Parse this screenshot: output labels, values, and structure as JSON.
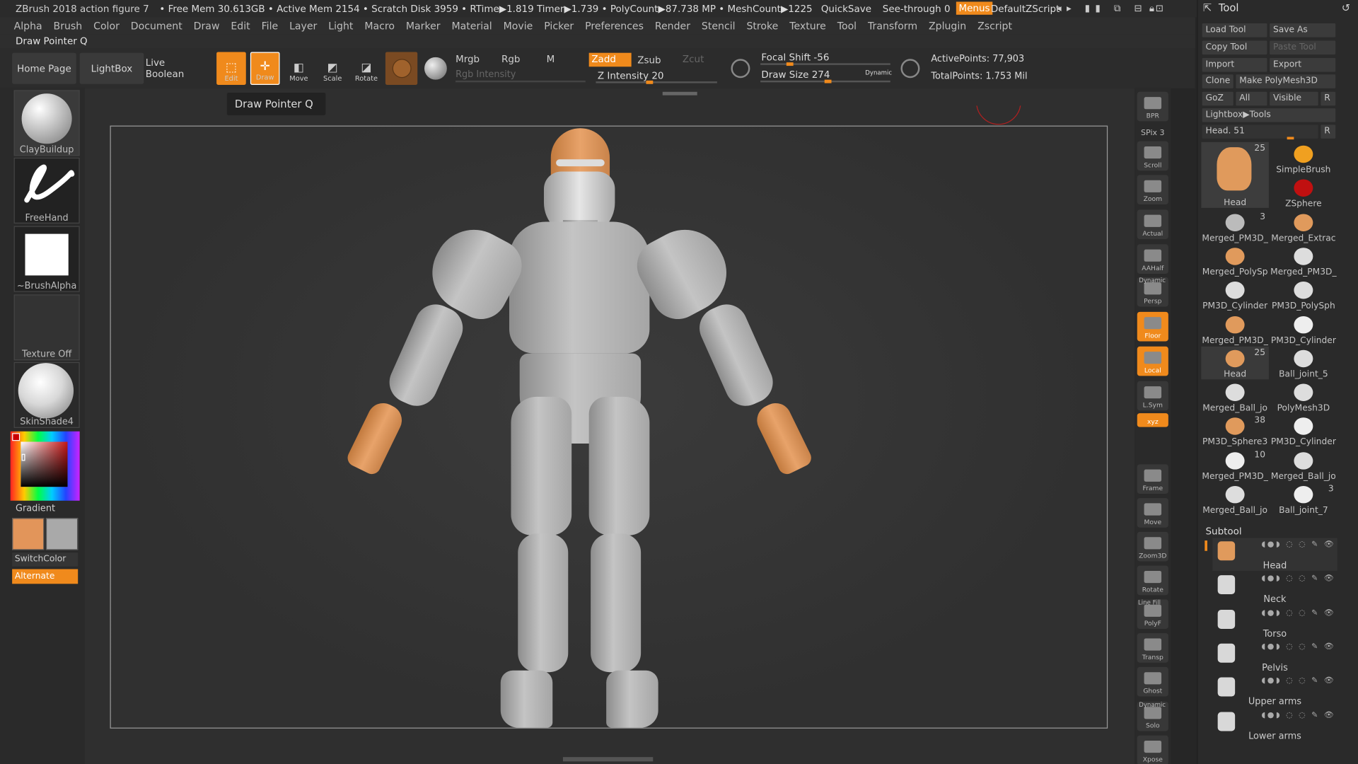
{
  "app": {
    "title": "ZBrush 2018 action figure 7",
    "stats": "• Free Mem 30.613GB • Active Mem 2154 • Scratch Disk 3959 • RTime▶1.819 Timer▶1.739 • PolyCount▶87.738 MP • MeshCount▶1225",
    "quicksave": "QuickSave",
    "seethrough": "See-through  0",
    "menus": "Menus",
    "zscript": "DefaultZScript"
  },
  "menubar": [
    "Alpha",
    "Brush",
    "Color",
    "Document",
    "Draw",
    "Edit",
    "File",
    "Layer",
    "Light",
    "Macro",
    "Marker",
    "Material",
    "Movie",
    "Picker",
    "Preferences",
    "Render",
    "Stencil",
    "Stroke",
    "Texture",
    "Tool",
    "Transform",
    "Zplugin",
    "Zscript"
  ],
  "status_text": "Draw Pointer Q",
  "toolbar": {
    "home": "Home Page",
    "lightbox": "LightBox",
    "liveboolean": "Live Boolean",
    "edit": "Edit",
    "draw": "Draw",
    "move": "Move",
    "scale": "Scale",
    "rotate": "Rotate",
    "mrgb": "Mrgb",
    "rgb": "Rgb",
    "m": "M",
    "zadd": "Zadd",
    "zsub": "Zsub",
    "zcut": "Zcut",
    "rgb_intensity": "Rgb Intensity",
    "z_intensity": "Z Intensity 20",
    "focal_shift": "Focal Shift -56",
    "draw_size": "Draw Size 274",
    "dynamic": "Dynamic",
    "active_points": "ActivePoints: 77,903",
    "total_points": "TotalPoints: 1.753 Mil"
  },
  "tooltip": "Draw Pointer  Q",
  "left": {
    "brush": "ClayBuildup",
    "stroke": "FreeHand",
    "alpha": "~BrushAlpha",
    "texture": "Texture Off",
    "material": "SkinShade4",
    "gradient": "Gradient",
    "switchcolor": "SwitchColor",
    "alternate": "Alternate",
    "main_color": "#e2955a",
    "secondary_color": "#a9a9a9"
  },
  "rightbar": [
    {
      "label": "BPR"
    },
    {
      "label": "SPix 3"
    },
    {
      "label": "Scroll"
    },
    {
      "label": "Zoom"
    },
    {
      "label": "Actual"
    },
    {
      "label": "AAHalf"
    },
    {
      "label": "Persp"
    },
    {
      "label": "Floor"
    },
    {
      "label": "Local"
    },
    {
      "label": "L.Sym"
    },
    {
      "label": "xyz"
    },
    {
      "label": "Frame"
    },
    {
      "label": "Move"
    },
    {
      "label": "Zoom3D"
    },
    {
      "label": "Rotate"
    },
    {
      "label": "PolyF"
    },
    {
      "label": "Transp"
    },
    {
      "label": "Ghost"
    },
    {
      "label": "Solo"
    },
    {
      "label": "Xpose"
    }
  ],
  "rightbar_extra": {
    "dynamic": "Dynamic",
    "linefill": "Line Fill",
    "dynamic2": "Dynamic"
  },
  "tool": {
    "title": "Tool",
    "load": "Load Tool",
    "saveas": "Save As",
    "copy": "Copy Tool",
    "paste": "Paste Tool",
    "import": "Import",
    "export": "Export",
    "clone": "Clone",
    "make": "Make PolyMesh3D",
    "goz": "GoZ",
    "all": "All",
    "visible": "Visible",
    "r": "R",
    "lightbox_tools": "Lightbox▶Tools",
    "current": "Head. 51",
    "grid": [
      {
        "label": "Head",
        "count": "25"
      },
      {
        "label": "SimpleBrush",
        "count": ""
      },
      {
        "label": "",
        "count": ""
      },
      {
        "label": "ZSphere",
        "count": ""
      },
      {
        "label": "Merged_PM3D_",
        "count": "3"
      },
      {
        "label": "Merged_Extrac",
        "count": ""
      },
      {
        "label": "Merged_PolySp",
        "count": ""
      },
      {
        "label": "Merged_PM3D_",
        "count": ""
      },
      {
        "label": "PM3D_Cylinder",
        "count": ""
      },
      {
        "label": "PM3D_PolySph",
        "count": ""
      },
      {
        "label": "Merged_PM3D_",
        "count": ""
      },
      {
        "label": "PM3D_Cylinder",
        "count": ""
      },
      {
        "label": "Head",
        "count": "25"
      },
      {
        "label": "Ball_joint_5",
        "count": ""
      },
      {
        "label": "Merged_Ball_jo",
        "count": ""
      },
      {
        "label": "PolyMesh3D",
        "count": ""
      },
      {
        "label": "PM3D_Sphere3",
        "count": "38"
      },
      {
        "label": "PM3D_Cylinder",
        "count": ""
      },
      {
        "label": "Merged_PM3D_",
        "count": "10"
      },
      {
        "label": "Merged_Ball_jo",
        "count": ""
      },
      {
        "label": "Merged_Ball_jo",
        "count": ""
      },
      {
        "label": "Ball_joint_7",
        "count": "3"
      }
    ],
    "subtool_title": "Subtool",
    "subtools": [
      "Head",
      "Neck",
      "Torso",
      "Pelvis",
      "Upper arms",
      "Lower arms"
    ]
  }
}
